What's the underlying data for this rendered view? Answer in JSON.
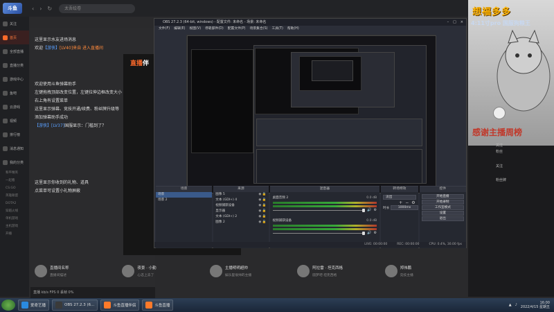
{
  "app": {
    "logo": "斗鱼",
    "search_placeholder": "太吾绘卷"
  },
  "sidebar": {
    "items": [
      {
        "label": "关注",
        "active": false
      },
      {
        "label": "首页",
        "active": true
      },
      {
        "label": "全部直播",
        "active": false
      },
      {
        "label": "直播分类",
        "active": false
      },
      {
        "label": "游戏中心",
        "active": false
      },
      {
        "label": "鱼吧",
        "active": false
      },
      {
        "label": "云游戏",
        "active": false
      },
      {
        "label": "视频",
        "active": false
      },
      {
        "label": "排行榜",
        "active": false
      },
      {
        "label": "消息通知",
        "active": false
      },
      {
        "label": "我的分类",
        "active": false
      }
    ],
    "sub_items": [
      "和平精英",
      "一起看",
      "CS:GO",
      "英雄联盟",
      "DOTA2",
      "穿越火线"
    ],
    "bottom_items": [
      "单机游戏",
      "主机游戏",
      "开播"
    ]
  },
  "chat": {
    "lines": [
      {
        "text": "这里显示水友进场消息",
        "tag": "",
        "tag_color": ""
      },
      {
        "text": "欢迎",
        "tag": "【游侠】",
        "tag_color": "blue",
        "extra": "[LV40]来自 进入直播间"
      },
      {
        "text": "欢迎使用斗鱼弹幕助手",
        "tag": "",
        "tag_color": ""
      },
      {
        "text": "左键拖拽顶部改变位置，左键拉伸边框改变大小",
        "tag": "",
        "tag_color": ""
      },
      {
        "text": "右上角有设置菜单",
        "tag": "",
        "tag_color": ""
      },
      {
        "text": "这里显示弹幕、竞技开通/续费、粉丝牌升级等",
        "tag": "",
        "tag_color": ""
      },
      {
        "text": "添加弹幕助手成功",
        "tag": "",
        "tag_color": ""
      },
      {
        "text": "国服显示：门槛到了？",
        "tag": "【游侠】[LV37]",
        "tag_color": "blue"
      },
      {
        "text": "这里显示你收到的礼物、道具",
        "tag": "",
        "tag_color": ""
      },
      {
        "text": "点菜单可设置小礼物屏蔽",
        "tag": "",
        "tag_color": ""
      }
    ],
    "footer": "直播 kb/s FPS 0 丢帧 0%",
    "game_panel_logo_a": "直播",
    "game_panel_logo_b": "伴"
  },
  "obs": {
    "title": "OBS 27.2.3 (64-bit, windows) - 配置文件: 未命名 - 场景: 未命名",
    "menu": [
      "文件(F)",
      "编辑(E)",
      "视图(V)",
      "停靠部件(D)",
      "配置文件(P)",
      "场景集合(S)",
      "工具(T)",
      "帮助(H)"
    ],
    "docks": {
      "scenes": {
        "title": "场景",
        "items": [
          "场景",
          "场景 2"
        ]
      },
      "sources": {
        "title": "来源",
        "items": [
          "图像 5",
          "文本 (GDI+) 4",
          "视频捕获设备",
          "显示器",
          "文本 (GDI+) 2",
          "图像 2"
        ]
      },
      "mixer": {
        "title": "混音器",
        "channels": [
          {
            "name": "桌面音频 2",
            "db": "0.0 dB"
          },
          {
            "name": "视频捕获设备",
            "db": "0.0 dB"
          }
        ]
      },
      "transitions": {
        "title": "转场特效",
        "type": "淡出",
        "duration_label": "时长",
        "duration": "1000ms"
      },
      "controls": {
        "title": "控件",
        "buttons": [
          "开始直播",
          "开始录制",
          "工作室模式",
          "设置",
          "退出"
        ]
      }
    },
    "status": {
      "live": "LIVE: 00:00:00",
      "rec": "REC: 00:00:00",
      "cpu": "CPU: 0.4%, 30.00 fps"
    }
  },
  "rightpanel": {
    "title": "想福多多",
    "subtitle": "4:11寸pro 国服狗粮王",
    "rank_text": "感谢主播周榜",
    "side_text_1": "关注",
    "side_text_2": "粉丝",
    "follow_btn": "关注",
    "fans_btn": "粉丝牌"
  },
  "cards": [
    {
      "name": "直播间名称",
      "desc": "直播间描述"
    },
    {
      "name": "夜景 · 小勤",
      "desc": "心态上去了"
    },
    {
      "name": "主播明明超帅",
      "desc": "娱乐里很帅的主播"
    },
    {
      "name": "阿拉雷 · 坦克西格",
      "desc": "圆梦吧 坦克西格"
    },
    {
      "name": "郑伟鹏",
      "desc": "竞技主播"
    }
  ],
  "taskbar": {
    "tasks": [
      {
        "label": "爱奇艺播",
        "color": "#2a8adf"
      },
      {
        "label": "OBS 27.2.3 (6...",
        "color": "#3a3a3a"
      },
      {
        "label": "斗鱼直播伴侣",
        "color": "#ff7a2a"
      },
      {
        "label": "斗鱼直播",
        "color": "#ff7a2a"
      }
    ],
    "time": "16:00",
    "date": "2022/4/15 星期五"
  }
}
